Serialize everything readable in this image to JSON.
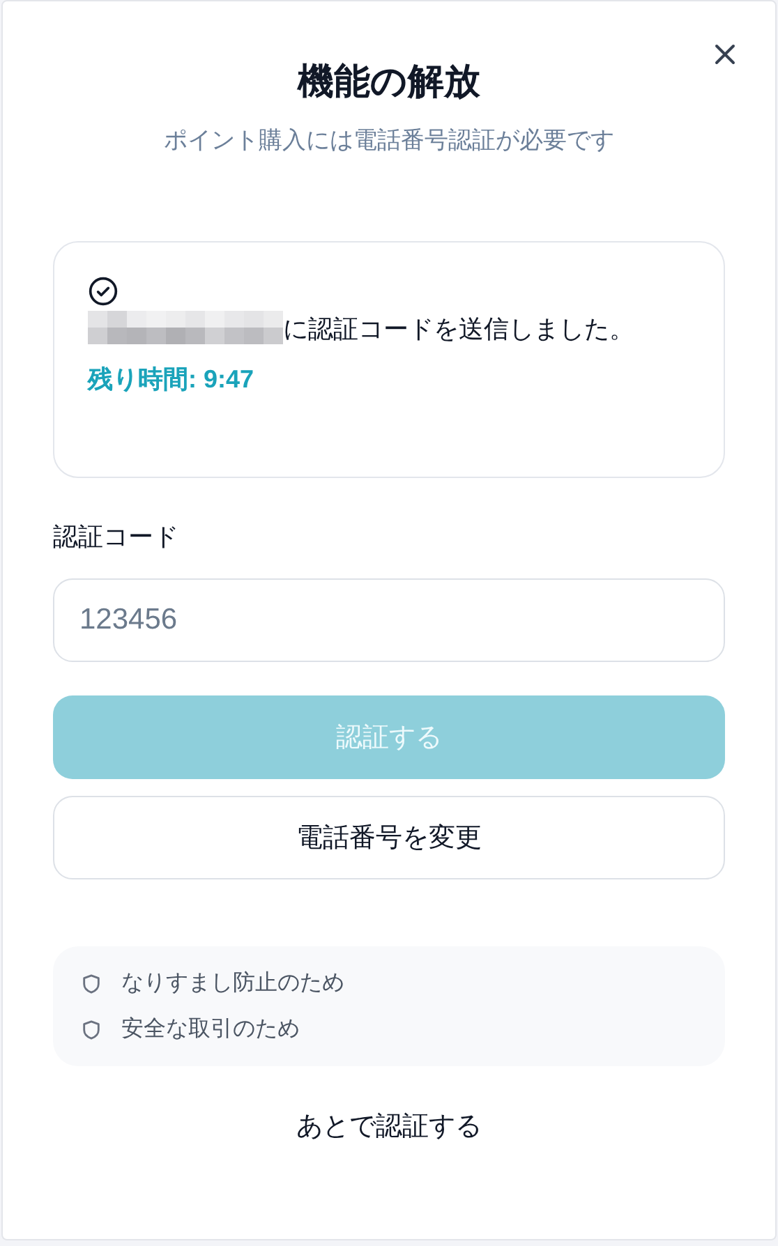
{
  "dialog": {
    "title": "機能の解放",
    "subtitle": "ポイント購入には電話番号認証が必要です"
  },
  "notice": {
    "message": "に認証コードを送信しました。",
    "timer": "残り時間: 9:47"
  },
  "code_field": {
    "label": "認証コード",
    "placeholder": "123456"
  },
  "verify_button": {
    "label": "認証する",
    "disabled": true
  },
  "change_phone_button": {
    "label": "電話番号を変更"
  },
  "reasons": [
    "なりすまし防止のため",
    "安全な取引のため"
  ],
  "later_link": "あとで認証する"
}
